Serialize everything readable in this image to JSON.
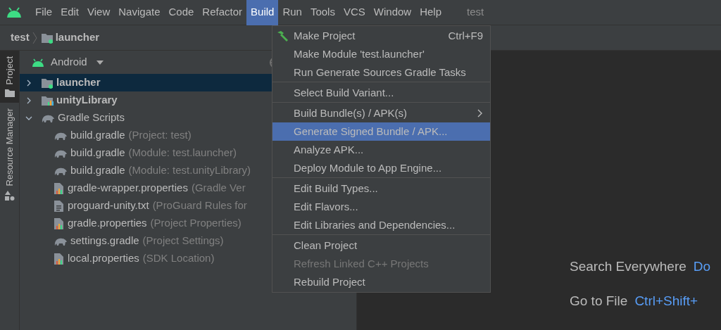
{
  "menu_bar": {
    "items": [
      {
        "label": "File",
        "selected": false
      },
      {
        "label": "Edit",
        "selected": false
      },
      {
        "label": "View",
        "selected": false
      },
      {
        "label": "Navigate",
        "selected": false
      },
      {
        "label": "Code",
        "selected": false
      },
      {
        "label": "Refactor",
        "selected": false
      },
      {
        "label": "Build",
        "selected": true
      },
      {
        "label": "Run",
        "selected": false
      },
      {
        "label": "Tools",
        "selected": false
      },
      {
        "label": "VCS",
        "selected": false
      },
      {
        "label": "Window",
        "selected": false
      },
      {
        "label": "Help",
        "selected": false
      }
    ],
    "project_title": "test"
  },
  "breadcrumb": [
    "test",
    "launcher"
  ],
  "side_tabs": [
    {
      "label": "Project",
      "selected": true
    },
    {
      "label": "Resource Manager",
      "selected": false
    }
  ],
  "project_panel": {
    "view": "Android",
    "tree": [
      {
        "name": "launcher",
        "kind": "app-module",
        "selected": true,
        "expanded": false
      },
      {
        "name": "unityLibrary",
        "kind": "library-module",
        "selected": false,
        "expanded": false
      },
      {
        "name": "Gradle Scripts",
        "kind": "gradle",
        "selected": false,
        "expanded": true,
        "children": [
          {
            "name": "build.gradle",
            "note": "(Project: test)",
            "kind": "gradle",
            "selected": false
          },
          {
            "name": "build.gradle",
            "note": "(Module: test.launcher)",
            "kind": "gradle",
            "selected": false
          },
          {
            "name": "build.gradle",
            "note": "(Module: test.unityLibrary)",
            "kind": "gradle",
            "selected": false
          },
          {
            "name": "gradle-wrapper.properties",
            "note": "(Gradle Ver",
            "kind": "properties",
            "selected": false
          },
          {
            "name": "proguard-unity.txt",
            "note": "(ProGuard Rules for",
            "kind": "text",
            "selected": false
          },
          {
            "name": "gradle.properties",
            "note": "(Project Properties)",
            "kind": "properties",
            "selected": false
          },
          {
            "name": "settings.gradle",
            "note": "(Project Settings)",
            "kind": "gradle",
            "selected": false
          },
          {
            "name": "local.properties",
            "note": "(SDK Location)",
            "kind": "properties",
            "selected": false
          }
        ]
      }
    ]
  },
  "build_menu": {
    "groups": [
      [
        {
          "label": "Make Project",
          "shortcut": "Ctrl+F9",
          "selected": false,
          "disabled": false,
          "submenu": false
        },
        {
          "label": "Make Module 'test.launcher'",
          "selected": false,
          "disabled": false,
          "submenu": false
        },
        {
          "label": "Run Generate Sources Gradle Tasks",
          "selected": false,
          "disabled": false,
          "submenu": false
        }
      ],
      [
        {
          "label": "Select Build Variant...",
          "selected": false,
          "disabled": false,
          "submenu": false
        }
      ],
      [
        {
          "label": "Build Bundle(s) / APK(s)",
          "selected": false,
          "disabled": false,
          "submenu": true
        },
        {
          "label": "Generate Signed Bundle / APK...",
          "selected": true,
          "disabled": false,
          "submenu": false
        },
        {
          "label": "Analyze APK...",
          "selected": false,
          "disabled": false,
          "submenu": false
        },
        {
          "label": "Deploy Module to App Engine...",
          "selected": false,
          "disabled": false,
          "submenu": false
        }
      ],
      [
        {
          "label": "Edit Build Types...",
          "selected": false,
          "disabled": false,
          "submenu": false
        },
        {
          "label": "Edit Flavors...",
          "selected": false,
          "disabled": false,
          "submenu": false
        },
        {
          "label": "Edit Libraries and Dependencies...",
          "selected": false,
          "disabled": false,
          "submenu": false
        }
      ],
      [
        {
          "label": "Clean Project",
          "selected": false,
          "disabled": false,
          "submenu": false
        },
        {
          "label": "Refresh Linked C++ Projects",
          "selected": false,
          "disabled": true,
          "submenu": false
        },
        {
          "label": "Rebuild Project",
          "selected": false,
          "disabled": false,
          "submenu": false
        }
      ]
    ]
  },
  "editor_hints": [
    {
      "label": "Search Everywhere",
      "shortcut": "Do"
    },
    {
      "label": "Go to File",
      "shortcut": "Ctrl+Shift+"
    }
  ]
}
